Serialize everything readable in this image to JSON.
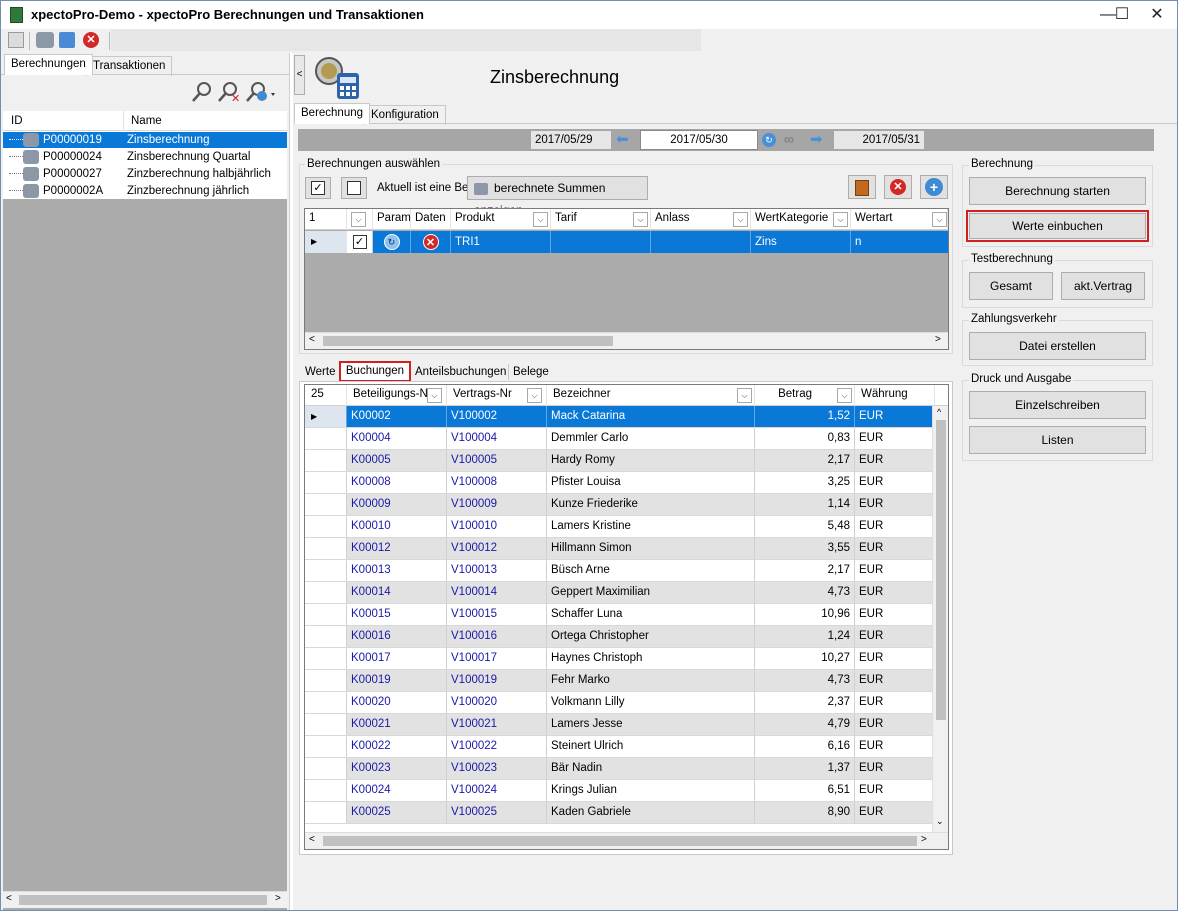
{
  "window": {
    "title": "xpectoPro-Demo - xpectoPro Berechnungen und Transaktionen",
    "minimize": "—",
    "maximize": "☐",
    "close": "✕"
  },
  "left": {
    "tabs": [
      "Berechnungen",
      "Transaktionen"
    ],
    "columns": [
      "ID",
      "Name"
    ],
    "rows": [
      {
        "id": "P00000019",
        "name": "Zinsberechnung"
      },
      {
        "id": "P00000024",
        "name": "Zinsberechnung Quartal"
      },
      {
        "id": "P00000027",
        "name": "Zinzberechnung halbjährlich"
      },
      {
        "id": "P0000002A",
        "name": "Zinzberechnung jährlich"
      }
    ]
  },
  "header": {
    "title": "Zinsberechnung",
    "collapse": "<"
  },
  "main_tabs": [
    "Berechnung",
    "Konfiguration"
  ],
  "dates": {
    "prev": "2017/05/29",
    "current": "2017/05/30",
    "next": "2017/05/31",
    "infinity": "∞"
  },
  "selection": {
    "group_title": "Berechnungen auswählen",
    "info_text": "Aktuell ist eine Be",
    "summen_button": "berechnete Summen anzeigen",
    "columns": [
      "1",
      "",
      "Param",
      "Daten",
      "Produkt",
      "Tarif",
      "Anlass",
      "WertKategorie",
      "Wertart"
    ],
    "row": {
      "produkt": "TRI1",
      "tarif": "",
      "anlass": "",
      "wertkategorie": "Zins",
      "wertart": "n"
    }
  },
  "lower_tabs": [
    "Werte",
    "Buchungen",
    "Anteilsbuchungen",
    "Belege"
  ],
  "bookings": {
    "count": "25",
    "columns": [
      "Beteiligungs-Nr",
      "Vertrags-Nr",
      "Bezeichner",
      "Betrag",
      "Währung"
    ],
    "rows": [
      {
        "bet": "K00002",
        "ver": "V100002",
        "bez": "Mack Catarina",
        "betrag": "1,52",
        "cur": "EUR"
      },
      {
        "bet": "K00004",
        "ver": "V100004",
        "bez": "Demmler Carlo",
        "betrag": "0,83",
        "cur": "EUR"
      },
      {
        "bet": "K00005",
        "ver": "V100005",
        "bez": "Hardy Romy",
        "betrag": "2,17",
        "cur": "EUR"
      },
      {
        "bet": "K00008",
        "ver": "V100008",
        "bez": "Pfister Louisa",
        "betrag": "3,25",
        "cur": "EUR"
      },
      {
        "bet": "K00009",
        "ver": "V100009",
        "bez": "Kunze Friederike",
        "betrag": "1,14",
        "cur": "EUR"
      },
      {
        "bet": "K00010",
        "ver": "V100010",
        "bez": "Lamers Kristine",
        "betrag": "5,48",
        "cur": "EUR"
      },
      {
        "bet": "K00012",
        "ver": "V100012",
        "bez": "Hillmann Simon",
        "betrag": "3,55",
        "cur": "EUR"
      },
      {
        "bet": "K00013",
        "ver": "V100013",
        "bez": "Büsch Arne",
        "betrag": "2,17",
        "cur": "EUR"
      },
      {
        "bet": "K00014",
        "ver": "V100014",
        "bez": "Geppert Maximilian",
        "betrag": "4,73",
        "cur": "EUR"
      },
      {
        "bet": "K00015",
        "ver": "V100015",
        "bez": "Schaffer Luna",
        "betrag": "10,96",
        "cur": "EUR"
      },
      {
        "bet": "K00016",
        "ver": "V100016",
        "bez": "Ortega Christopher",
        "betrag": "1,24",
        "cur": "EUR"
      },
      {
        "bet": "K00017",
        "ver": "V100017",
        "bez": "Haynes Christoph",
        "betrag": "10,27",
        "cur": "EUR"
      },
      {
        "bet": "K00019",
        "ver": "V100019",
        "bez": "Fehr Marko",
        "betrag": "4,73",
        "cur": "EUR"
      },
      {
        "bet": "K00020",
        "ver": "V100020",
        "bez": "Volkmann Lilly",
        "betrag": "2,37",
        "cur": "EUR"
      },
      {
        "bet": "K00021",
        "ver": "V100021",
        "bez": "Lamers Jesse",
        "betrag": "4,79",
        "cur": "EUR"
      },
      {
        "bet": "K00022",
        "ver": "V100022",
        "bez": "Steinert Ulrich",
        "betrag": "6,16",
        "cur": "EUR"
      },
      {
        "bet": "K00023",
        "ver": "V100023",
        "bez": "Bär Nadin",
        "betrag": "1,37",
        "cur": "EUR"
      },
      {
        "bet": "K00024",
        "ver": "V100024",
        "bez": "Krings Julian",
        "betrag": "6,51",
        "cur": "EUR"
      },
      {
        "bet": "K00025",
        "ver": "V100025",
        "bez": "Kaden Gabriele",
        "betrag": "8,90",
        "cur": "EUR"
      }
    ]
  },
  "right": {
    "berechnung": {
      "title": "Berechnung",
      "start": "Berechnung starten",
      "einbuchen": "Werte einbuchen"
    },
    "test": {
      "title": "Testberechnung",
      "gesamt": "Gesamt",
      "vertrag": "akt.Vertrag"
    },
    "zahlung": {
      "title": "Zahlungsverkehr",
      "datei": "Datei erstellen"
    },
    "druck": {
      "title": "Druck und Ausgabe",
      "einzel": "Einzelschreiben",
      "listen": "Listen"
    }
  },
  "colors": {
    "selection": "#0a78d7",
    "highlight_border": "#d21f1f",
    "link_blue": "#1a1aa8"
  }
}
